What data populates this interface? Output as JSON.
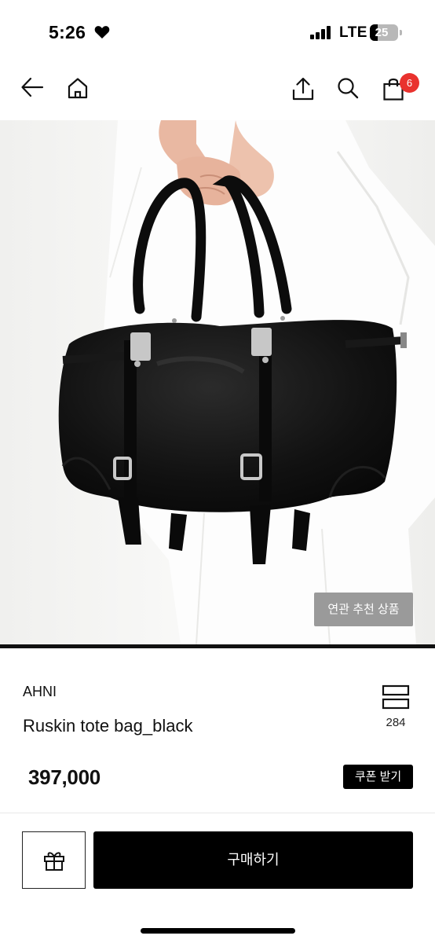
{
  "status_bar": {
    "time": "5:26",
    "network": "LTE",
    "battery": "25",
    "battery_level": 0.25,
    "icons": [
      "heart-icon",
      "signal-icon",
      "battery-icon"
    ]
  },
  "nav": {
    "icons": [
      "back-arrow-icon",
      "home-icon",
      "share-icon",
      "search-icon",
      "shopping-bag-icon"
    ],
    "cart_count": "6",
    "badge_color": "#e9322e"
  },
  "product": {
    "related_label": "연관 추천 상품",
    "brand": "AHNI",
    "name": "Ruskin tote bag_black",
    "like_count": "284",
    "price": "397,000",
    "coupon_label": "쿠폰 받기"
  },
  "actions": {
    "gift_icon": "gift-icon",
    "buy_label": "구매하기"
  }
}
